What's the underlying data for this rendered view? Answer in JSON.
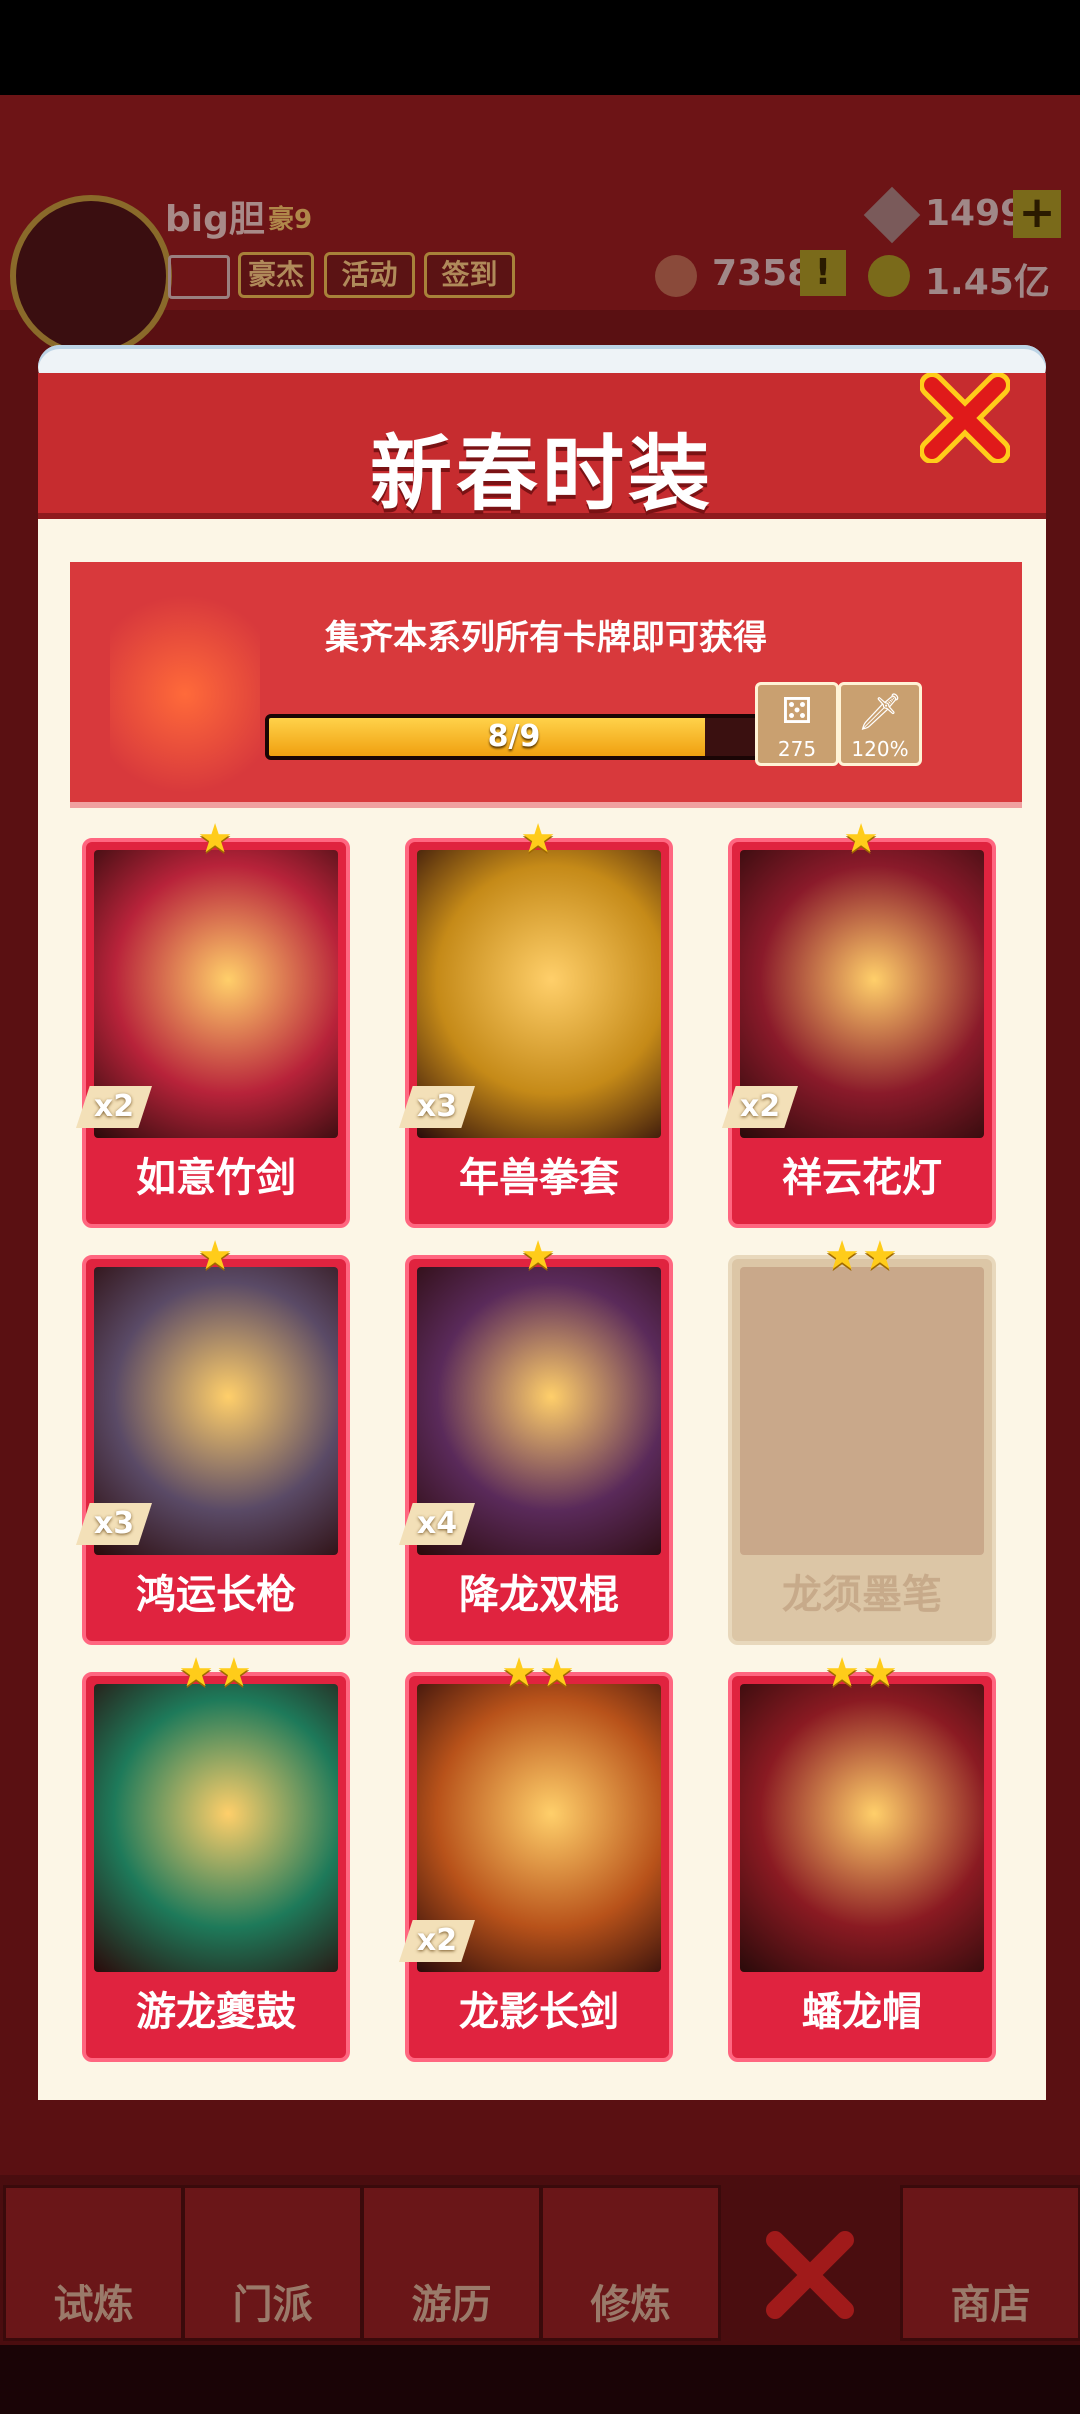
{
  "player": {
    "name": "big胆",
    "rank": "豪9",
    "gems": "1499",
    "tokens": "7358",
    "gold": "1.45亿"
  },
  "top_buttons": [
    "豪杰",
    "活动",
    "签到"
  ],
  "nav": [
    "试炼",
    "门派",
    "游历",
    "修炼",
    "商店"
  ],
  "dialog": {
    "title": "新春时装",
    "banner_text": "集齐本系列所有卡牌即可获得",
    "progress": {
      "text": "8/9",
      "fraction": 0.889
    },
    "rewards": [
      {
        "icon": "dice-icon",
        "value": "275"
      },
      {
        "icon": "sword-icon",
        "value": "120%"
      }
    ]
  },
  "cards": [
    {
      "name": "如意竹剑",
      "count": "x2",
      "stars": "★",
      "color": "#b8233a"
    },
    {
      "name": "年兽拳套",
      "count": "x3",
      "stars": "★",
      "color": "#c58a18"
    },
    {
      "name": "祥云花灯",
      "count": "x2",
      "stars": "★",
      "color": "#8a1a2a"
    },
    {
      "name": "鸿运长枪",
      "count": "x3",
      "stars": "★",
      "color": "#5a4a66"
    },
    {
      "name": "降龙双棍",
      "count": "x4",
      "stars": "★",
      "color": "#5a2a5a"
    },
    {
      "name": "龙须墨笔",
      "count": "",
      "stars": "★★",
      "color": "#c9a88a",
      "locked": true
    },
    {
      "name": "游龙夔鼓",
      "count": "",
      "stars": "★★",
      "color": "#1e7a5a"
    },
    {
      "name": "龙影长剑",
      "count": "x2",
      "stars": "★★",
      "color": "#b8521a"
    },
    {
      "name": "蟠龙帽",
      "count": "",
      "stars": "★★",
      "color": "#8a1a22"
    }
  ]
}
